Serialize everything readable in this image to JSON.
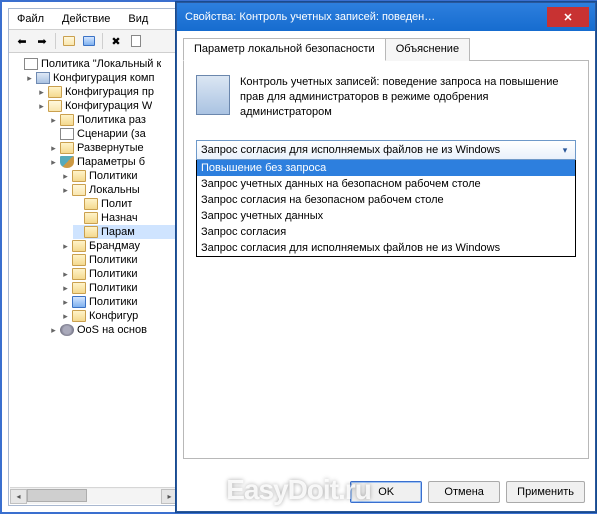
{
  "mmc": {
    "menu": {
      "file": "Файл",
      "action": "Действие",
      "view": "Вид"
    },
    "tree": [
      {
        "indent": 0,
        "tw": "",
        "icon": "doc",
        "label": "Политика \"Локальный к"
      },
      {
        "indent": 1,
        "tw": "▸",
        "icon": "pc",
        "label": "Конфигурация комп"
      },
      {
        "indent": 2,
        "tw": "▸",
        "icon": "folder",
        "label": "Конфигурация пр"
      },
      {
        "indent": 2,
        "tw": "▸",
        "icon": "folder-open",
        "label": "Конфигурация W"
      },
      {
        "indent": 3,
        "tw": "▸",
        "icon": "folder",
        "label": "Политика раз"
      },
      {
        "indent": 3,
        "tw": "",
        "icon": "doc",
        "label": "Сценарии (за"
      },
      {
        "indent": 3,
        "tw": "▸",
        "icon": "folder",
        "label": "Развернутые"
      },
      {
        "indent": 3,
        "tw": "▸",
        "icon": "shield",
        "label": "Параметры б"
      },
      {
        "indent": 4,
        "tw": "▸",
        "icon": "folder",
        "label": "Политики"
      },
      {
        "indent": 4,
        "tw": "▸",
        "icon": "folder-open",
        "label": "Локальны"
      },
      {
        "indent": 5,
        "tw": "",
        "icon": "folder",
        "label": "Полит"
      },
      {
        "indent": 5,
        "tw": "",
        "icon": "folder",
        "label": "Назнач"
      },
      {
        "indent": 5,
        "tw": "",
        "icon": "folder",
        "label": "Парам",
        "sel": true
      },
      {
        "indent": 4,
        "tw": "▸",
        "icon": "folder",
        "label": "Брандмау"
      },
      {
        "indent": 4,
        "tw": "",
        "icon": "folder",
        "label": "Политики"
      },
      {
        "indent": 4,
        "tw": "▸",
        "icon": "folder",
        "label": "Политики"
      },
      {
        "indent": 4,
        "tw": "▸",
        "icon": "folder",
        "label": "Политики"
      },
      {
        "indent": 4,
        "tw": "▸",
        "icon": "folder-blue",
        "label": "Политики"
      },
      {
        "indent": 4,
        "tw": "▸",
        "icon": "folder",
        "label": "Конфигур"
      },
      {
        "indent": 3,
        "tw": "▸",
        "icon": "cog",
        "label": "OoS на основ"
      }
    ]
  },
  "dialog": {
    "title": "Свойства: Контроль учетных записей: поведен…",
    "tabs": {
      "local": "Параметр локальной безопасности",
      "explain": "Объяснение"
    },
    "policy_desc": "Контроль учетных записей: поведение запроса на повышение прав для администраторов в режиме одобрения администратором",
    "combo_value": "Запрос согласия для исполняемых файлов не из Windows",
    "options": [
      "Повышение без запроса",
      "Запрос учетных данных на безопасном рабочем столе",
      "Запрос согласия на безопасном рабочем столе",
      "Запрос учетных данных",
      "Запрос согласия",
      "Запрос согласия для исполняемых файлов не из Windows"
    ],
    "buttons": {
      "ok": "OK",
      "cancel": "Отмена",
      "apply": "Применить"
    }
  },
  "watermark": "EasyDoit.ru"
}
